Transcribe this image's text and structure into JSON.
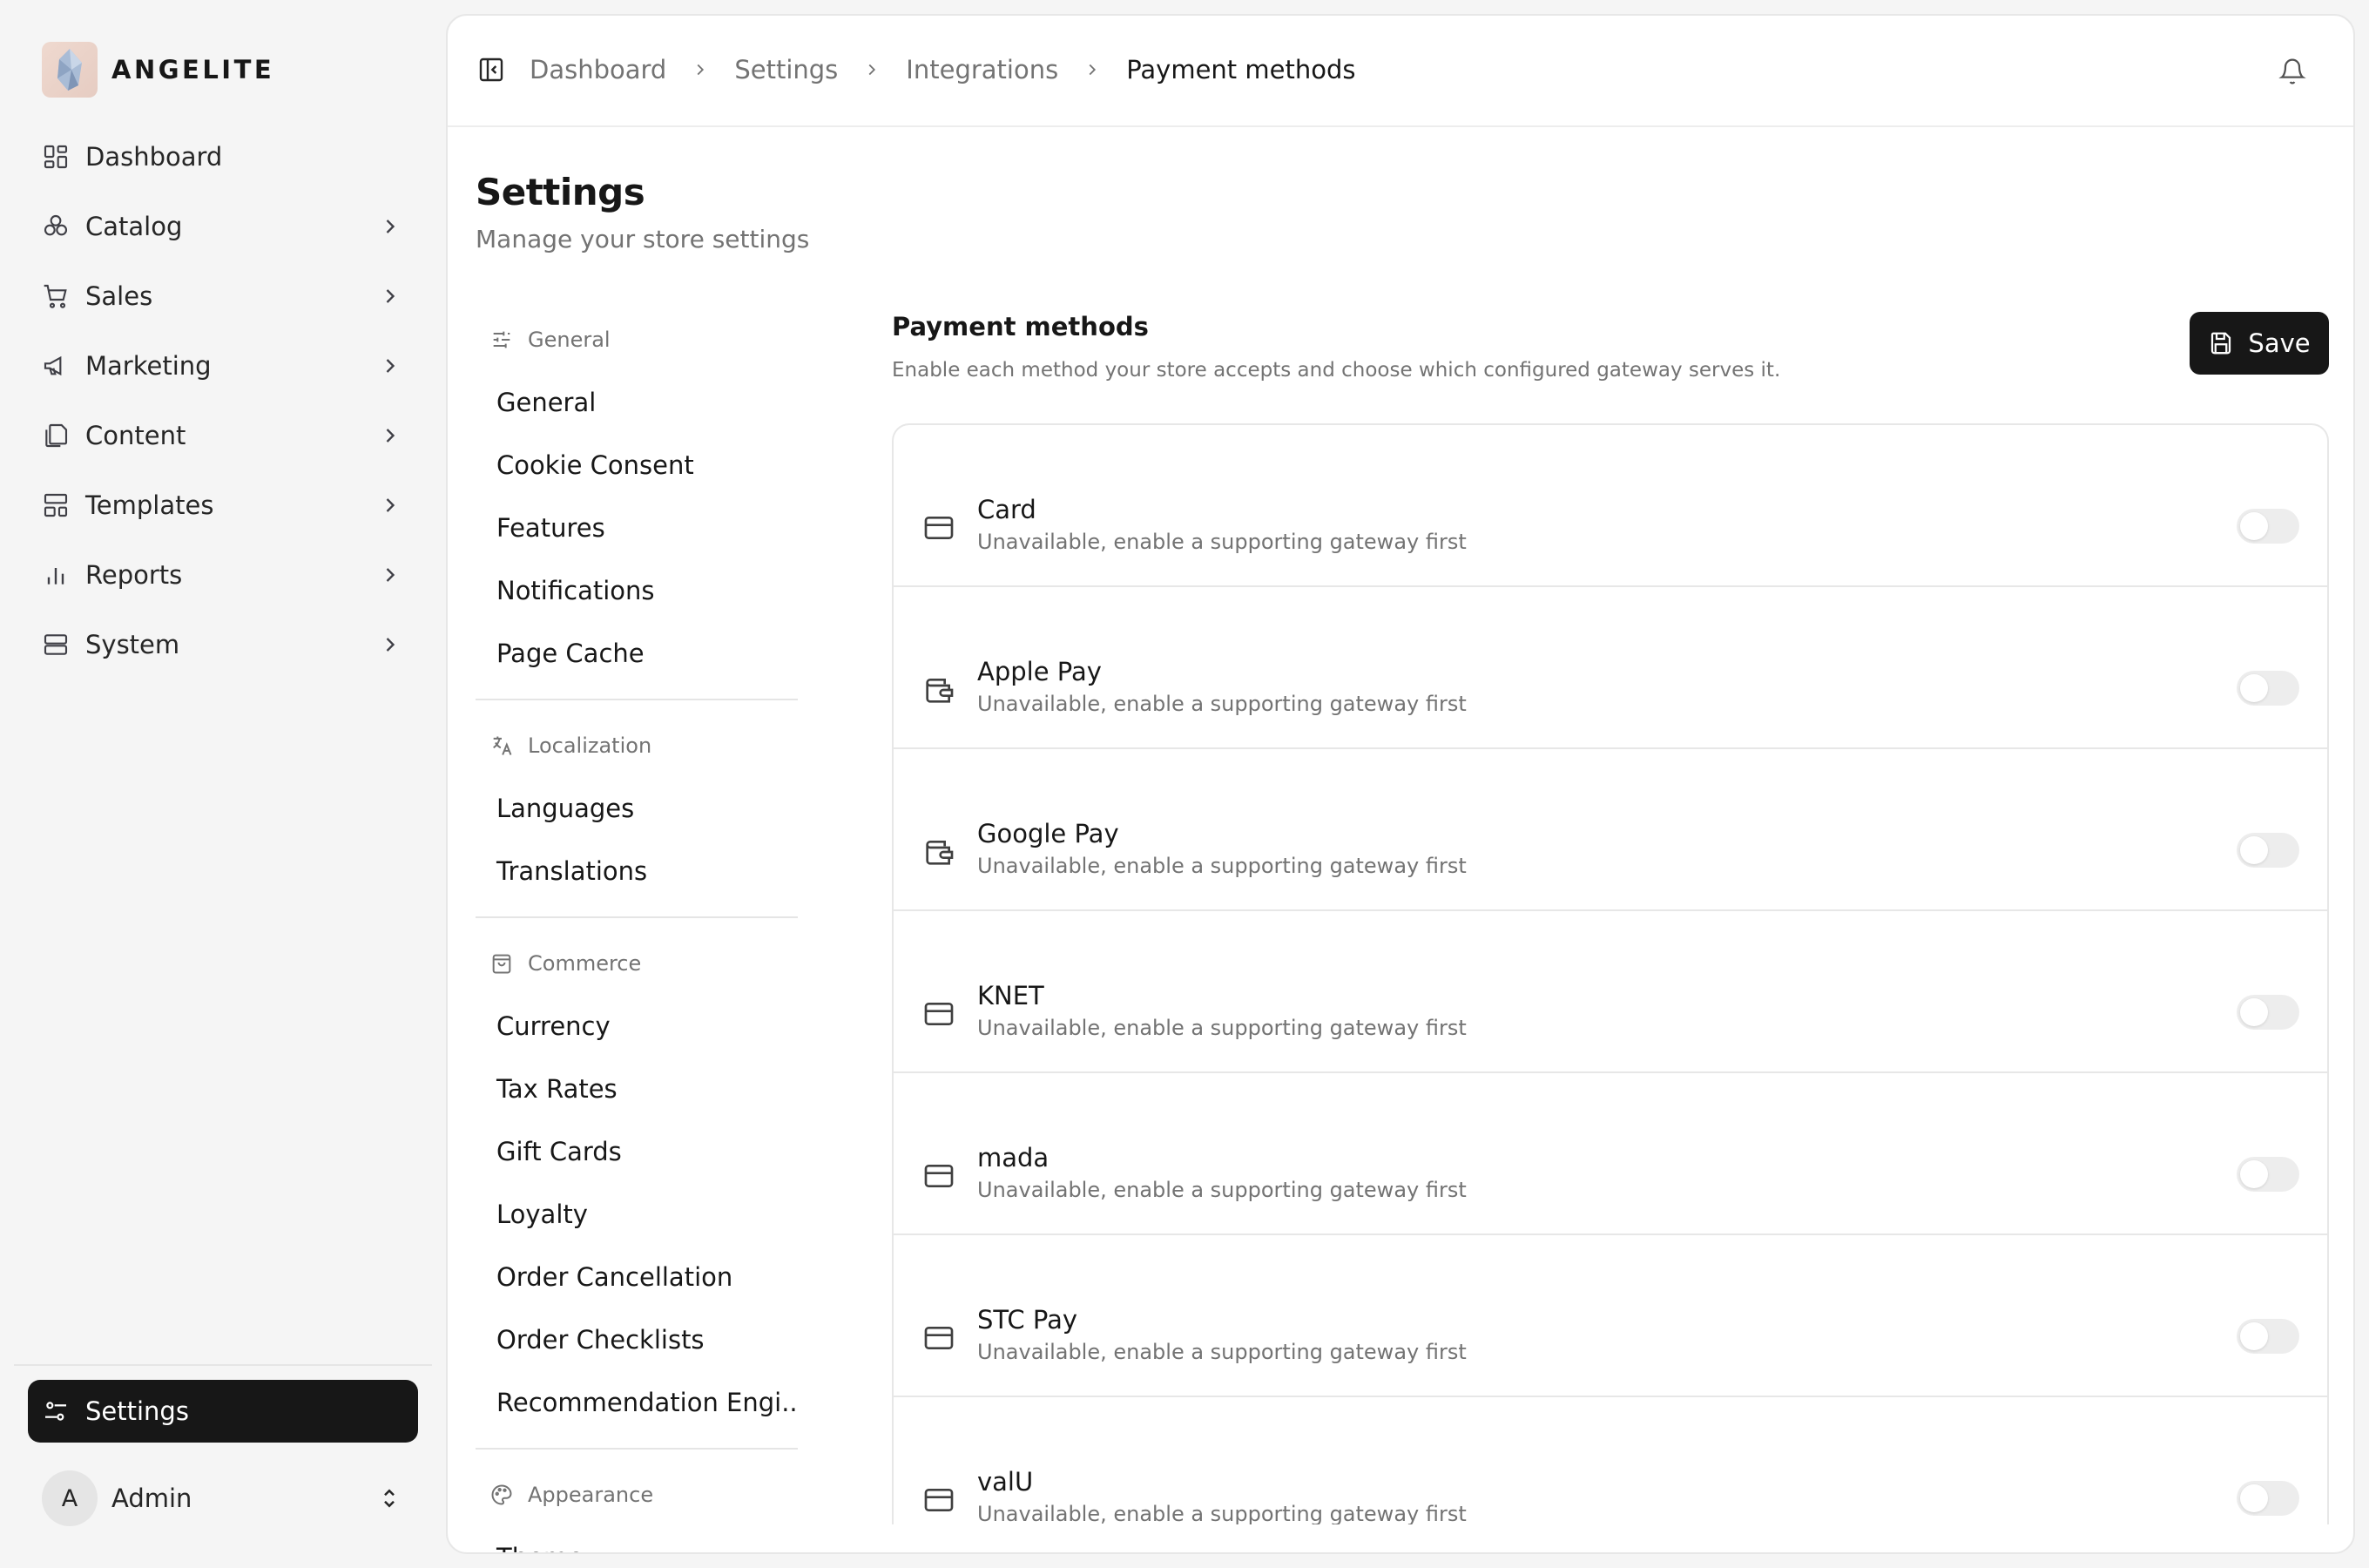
{
  "brand": {
    "name": "ANGELITE"
  },
  "sidebar": {
    "items": [
      {
        "label": "Dashboard",
        "icon": "dashboard-icon",
        "has_chevron": false
      },
      {
        "label": "Catalog",
        "icon": "catalog-icon",
        "has_chevron": true
      },
      {
        "label": "Sales",
        "icon": "cart-icon",
        "has_chevron": true
      },
      {
        "label": "Marketing",
        "icon": "megaphone-icon",
        "has_chevron": true
      },
      {
        "label": "Content",
        "icon": "pages-icon",
        "has_chevron": true
      },
      {
        "label": "Templates",
        "icon": "layout-icon",
        "has_chevron": true
      },
      {
        "label": "Reports",
        "icon": "bar-chart-icon",
        "has_chevron": true
      },
      {
        "label": "System",
        "icon": "server-icon",
        "has_chevron": true
      }
    ],
    "active_item": {
      "label": "Settings",
      "icon": "settings-sliders-icon"
    },
    "user": {
      "initial": "A",
      "name": "Admin"
    }
  },
  "breadcrumb": [
    "Dashboard",
    "Settings",
    "Integrations",
    "Payment methods"
  ],
  "page": {
    "title": "Settings",
    "subtitle": "Manage your store settings"
  },
  "settings_nav": {
    "groups": [
      {
        "title": "General",
        "icon": "sliders-icon",
        "items": [
          "General",
          "Cookie Consent",
          "Features",
          "Notifications",
          "Page Cache"
        ]
      },
      {
        "title": "Localization",
        "icon": "translate-icon",
        "items": [
          "Languages",
          "Translations"
        ]
      },
      {
        "title": "Commerce",
        "icon": "shopping-bag-icon",
        "items": [
          "Currency",
          "Tax Rates",
          "Gift Cards",
          "Loyalty",
          "Order Cancellation",
          "Order Checklists",
          "Recommendation Engi..."
        ]
      },
      {
        "title": "Appearance",
        "icon": "palette-icon",
        "items": [
          "Theme"
        ]
      }
    ]
  },
  "payment_methods": {
    "title": "Payment methods",
    "description": "Enable each method your store accepts and choose which configured gateway serves it.",
    "save_label": "Save",
    "methods": [
      {
        "name": "Card",
        "status": "Unavailable, enable a supporting gateway first",
        "icon": "credit-card-icon",
        "enabled": false
      },
      {
        "name": "Apple Pay",
        "status": "Unavailable, enable a supporting gateway first",
        "icon": "wallet-icon",
        "enabled": false
      },
      {
        "name": "Google Pay",
        "status": "Unavailable, enable a supporting gateway first",
        "icon": "wallet-icon",
        "enabled": false
      },
      {
        "name": "KNET",
        "status": "Unavailable, enable a supporting gateway first",
        "icon": "credit-card-icon",
        "enabled": false
      },
      {
        "name": "mada",
        "status": "Unavailable, enable a supporting gateway first",
        "icon": "credit-card-icon",
        "enabled": false
      },
      {
        "name": "STC Pay",
        "status": "Unavailable, enable a supporting gateway first",
        "icon": "credit-card-icon",
        "enabled": false
      },
      {
        "name": "valU",
        "status": "Unavailable, enable a supporting gateway first",
        "icon": "credit-card-icon",
        "enabled": false
      }
    ]
  }
}
